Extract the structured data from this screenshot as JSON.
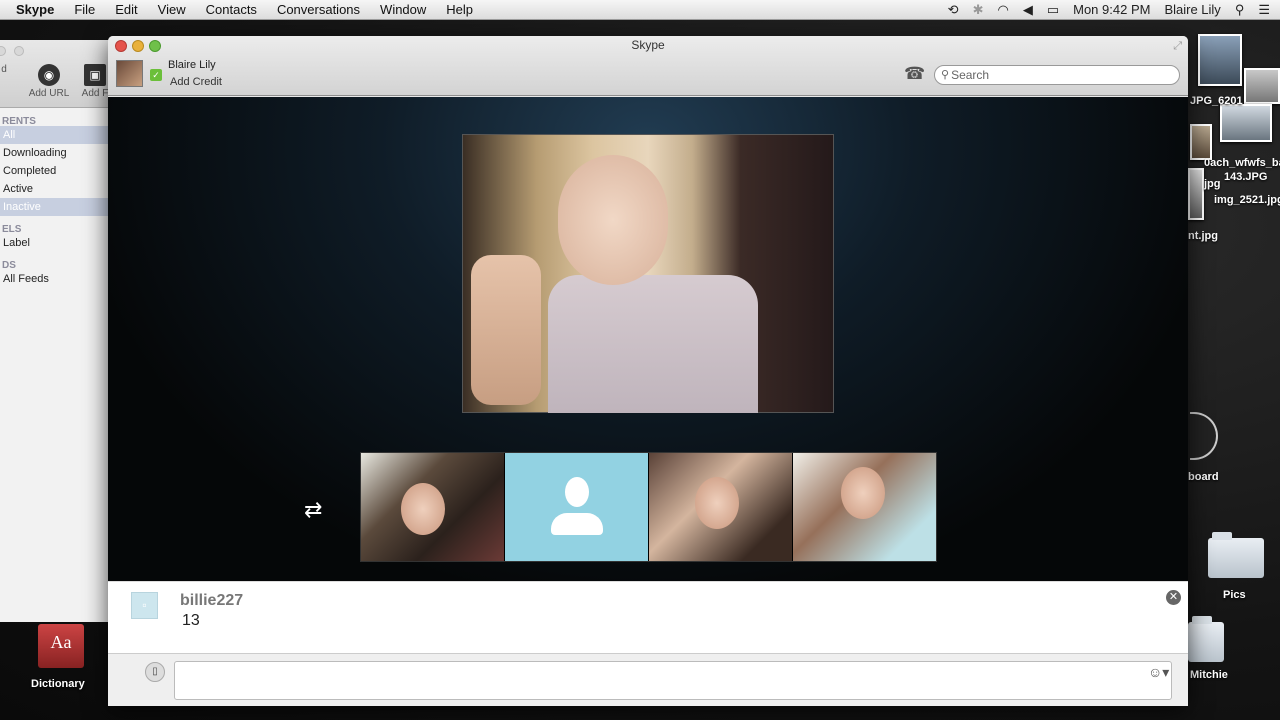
{
  "menubar": {
    "app": "Skype",
    "items": [
      "File",
      "Edit",
      "View",
      "Contacts",
      "Conversations",
      "Window",
      "Help"
    ],
    "clock": "Mon 9:42 PM",
    "user": "Blaire Lily",
    "icons": [
      "time-machine-icon",
      "bluetooth-icon",
      "wifi-icon",
      "volume-icon",
      "battery-icon",
      "spotlight-icon",
      "notification-list-icon"
    ]
  },
  "background_app": {
    "toolbar": [
      "d",
      "Add URL",
      "Add F"
    ],
    "section_torrents": "RENTS",
    "items": [
      "All",
      "Downloading",
      "Completed",
      "Active",
      "Inactive"
    ],
    "section_labels": "ELS",
    "label_item": "Label",
    "section_feeds": "DS",
    "feeds_item": "All Feeds"
  },
  "desktop": {
    "files": [
      "JPG_6201",
      "0ach_wfwfs_ba",
      "143.JPG",
      "img_2521.jpg",
      "jpg",
      "nt.jpg",
      "board",
      "Pics",
      "Mitchie",
      "Dictionary"
    ],
    "dictionary_glyph": "Aa"
  },
  "skype": {
    "window_title": "Skype",
    "user_name": "Blaire Lily",
    "add_credit": "Add Credit",
    "search_placeholder": "Search",
    "chat": {
      "sender": "billie227",
      "message": "13"
    }
  }
}
